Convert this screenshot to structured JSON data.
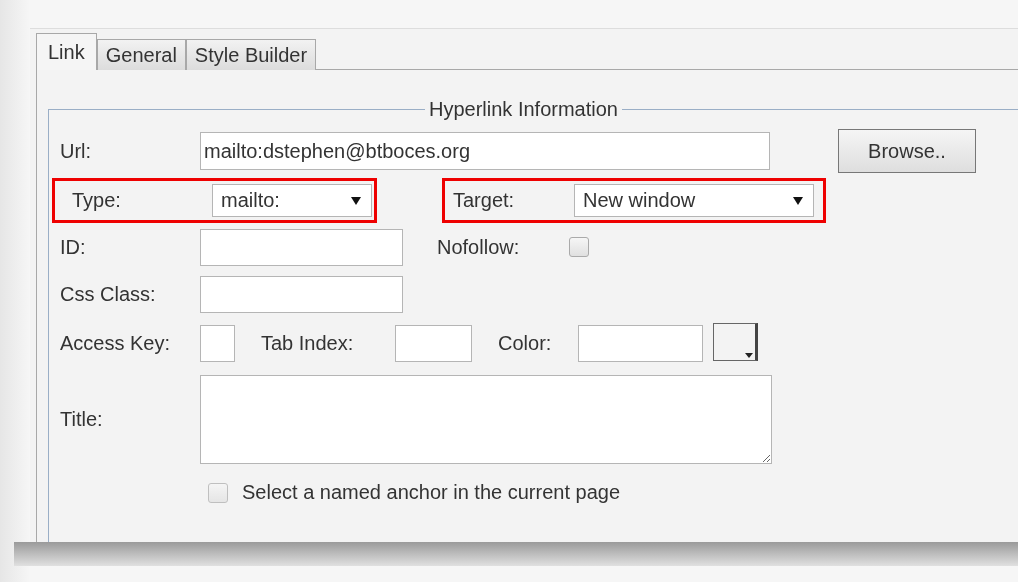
{
  "tabs": [
    {
      "label": "Link",
      "selected": true
    },
    {
      "label": "General",
      "selected": false
    },
    {
      "label": "Style Builder",
      "selected": false
    }
  ],
  "legend": "Hyperlink Information",
  "url": {
    "label": "Url:",
    "value": "mailto:dstephen@btboces.org"
  },
  "browse_button": "Browse..",
  "type": {
    "label": "Type:",
    "value": "mailto:",
    "highlighted": true
  },
  "target": {
    "label": "Target:",
    "value": "New window",
    "highlighted": true
  },
  "id": {
    "label": "ID:"
  },
  "nofollow": {
    "label": "Nofollow:",
    "checked": false
  },
  "css_class": {
    "label": "Css Class:"
  },
  "access_key": {
    "label": "Access Key:"
  },
  "tab_index": {
    "label": "Tab Index:"
  },
  "color": {
    "label": "Color:"
  },
  "title": {
    "label": "Title:"
  },
  "anchor_option": {
    "label": "Select a named anchor in the current page",
    "checked": false
  }
}
